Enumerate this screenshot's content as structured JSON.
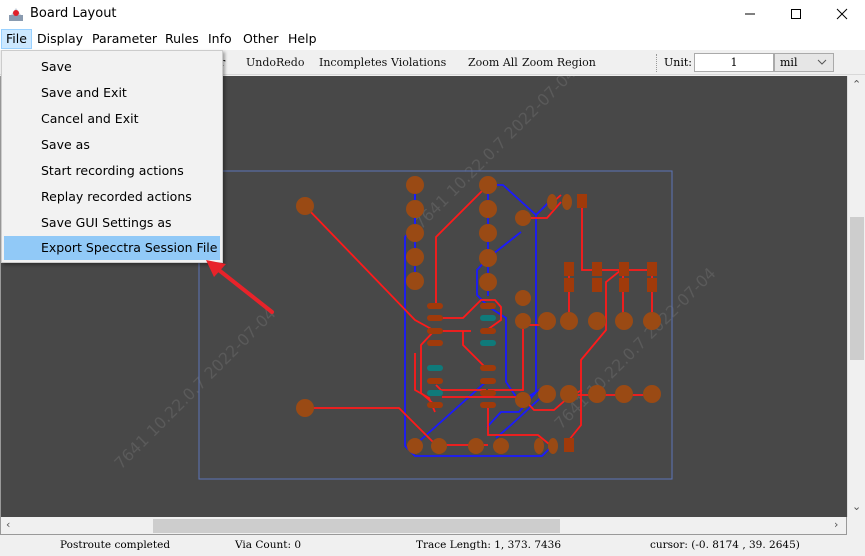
{
  "window": {
    "title": "Board Layout",
    "app_icon": "board-layout-app-icon",
    "controls": [
      "minimize",
      "maximize",
      "close"
    ]
  },
  "menubar": {
    "items": [
      {
        "label": "File",
        "active": true
      },
      {
        "label": "Display"
      },
      {
        "label": "Parameter"
      },
      {
        "label": "Rules"
      },
      {
        "label": "Info"
      },
      {
        "label": "Other"
      },
      {
        "label": "Help"
      }
    ]
  },
  "toolbar": {
    "partial_label": "r",
    "undo": "Undo",
    "redo": "Redo",
    "incompletes": "Incompletes",
    "violations": "Violations",
    "zoom_all": "Zoom All",
    "zoom_region": "Zoom Region",
    "unit_label": "Unit:",
    "unit_value": "1",
    "unit_select": "mil"
  },
  "file_menu": {
    "items": [
      {
        "label": "Save"
      },
      {
        "label": "Save and Exit"
      },
      {
        "label": "Cancel and Exit"
      },
      {
        "label": "Save as"
      },
      {
        "label": "Start recording actions"
      },
      {
        "label": "Replay recorded actions"
      },
      {
        "label": "Save GUI Settings as Default"
      },
      {
        "label": "Export Specctra Session File",
        "highlighted": true
      }
    ]
  },
  "status": {
    "message": "Postroute completed",
    "via_count": "Via Count:  0",
    "trace_length": "Trace Length:  1, 373. 7436",
    "cursor": "cursor:   (-0. 8174 ,  39. 2645)"
  },
  "colors": {
    "canvas_bg": "#484848",
    "board_outline": "#5b74b8",
    "top_trace": "#ff1a1a",
    "bottom_trace": "#1a1aff",
    "pad": "#9a4a14",
    "smd_pad": "#a03a0a",
    "teal_pad": "#0f7a7a",
    "menu_highlight": "#91c9f7",
    "annotation_arrow": "#e8232a"
  }
}
